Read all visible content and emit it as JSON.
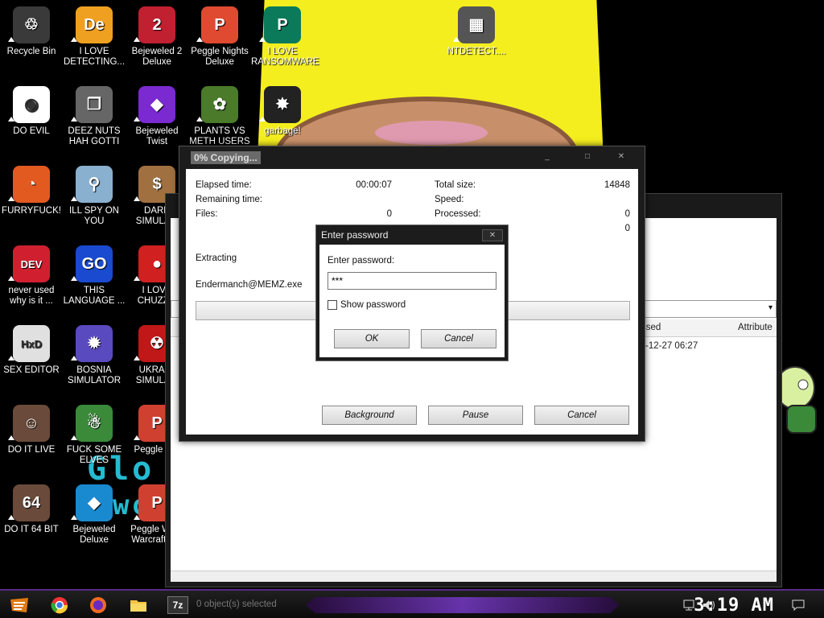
{
  "desktop": {
    "icons": [
      {
        "label": "Recycle Bin",
        "icon": "recycle-bin-icon",
        "color": "#3a3a3a",
        "glyph": "♲"
      },
      {
        "label": "I LOVE\nDETECTING...",
        "icon": "de-icon",
        "color": "#f0a020",
        "glyph": "De"
      },
      {
        "label": "Bejeweled 2\nDeluxe",
        "icon": "bejeweled2-icon",
        "color": "#c02030",
        "glyph": "2"
      },
      {
        "label": "Peggle Nights\nDeluxe",
        "icon": "peggle-nights-icon",
        "color": "#e04a30",
        "glyph": "P"
      },
      {
        "label": "I LOVE\nRANSOMWARE",
        "icon": "publisher-icon",
        "color": "#0b7a5a",
        "glyph": "P"
      },
      {
        "label": "NTDETECT....",
        "icon": "ntdetect-icon",
        "color": "#555",
        "glyph": "▦"
      },
      {
        "label": "DO EVIL",
        "icon": "chrome-icon",
        "color": "#ffffff",
        "glyph": "◉"
      },
      {
        "label": "DEEZ NUTS\nHAH GOTTI",
        "icon": "windows-copy-icon",
        "color": "#666",
        "glyph": "❐"
      },
      {
        "label": "Bejeweled\nTwist",
        "icon": "bejeweled-twist-icon",
        "color": "#7a2ad0",
        "glyph": "◆"
      },
      {
        "label": "PLANTS VS\nMETH USERS",
        "icon": "plants-icon",
        "color": "#4a7a2a",
        "glyph": "✿"
      },
      {
        "label": "garbage!",
        "icon": "garbage-icon",
        "color": "#222",
        "glyph": "✸"
      },
      {
        "label": "FURRYFUCK!",
        "icon": "firefox-icon",
        "color": "#e25a20",
        "glyph": "◔"
      },
      {
        "label": "ILL SPY ON\nYOU",
        "icon": "spy-icon",
        "color": "#8ab0d0",
        "glyph": "⚲"
      },
      {
        "label": "DARK\nSIMULA...",
        "icon": "money-bag-icon",
        "color": "#a07040",
        "glyph": "$"
      },
      {
        "label": "never used\nwhy is it ...",
        "icon": "dev-cpp-icon",
        "color": "#d02030",
        "glyph": "DEV"
      },
      {
        "label": "THIS\nLANGUAGE ...",
        "icon": "goland-icon",
        "color": "#1a4ad0",
        "glyph": "GO"
      },
      {
        "label": "I LOVE\nCHUZZ...",
        "icon": "chuzzle-icon",
        "color": "#d02020",
        "glyph": "●"
      },
      {
        "label": "SEX EDITOR",
        "icon": "hxd-icon",
        "color": "#e0e0e0",
        "glyph": "HxD"
      },
      {
        "label": "BOSNIA\nSIMULATOR",
        "icon": "mine-icon",
        "color": "#5a4ac0",
        "glyph": "✹"
      },
      {
        "label": "UKRAI...\nSIMULA...",
        "icon": "radiation-icon",
        "color": "#c01818",
        "glyph": "☢"
      },
      {
        "label": "DO IT LIVE",
        "icon": "portrait-icon",
        "color": "#6a4a3a",
        "glyph": "☺"
      },
      {
        "label": "FUCK SOME\nELVES",
        "icon": "elves-icon",
        "color": "#3a8a3a",
        "glyph": "☃"
      },
      {
        "label": "Peggle D...",
        "icon": "peggle-deluxe-icon",
        "color": "#d04030",
        "glyph": "P"
      },
      {
        "label": "DO IT 64 BIT",
        "icon": "portrait-64-icon",
        "color": "#6a4a3a",
        "glyph": "64"
      },
      {
        "label": "Bejeweled\nDeluxe",
        "icon": "bejeweled-icon",
        "color": "#1a8ad0",
        "glyph": "◆"
      },
      {
        "label": "Peggle Wo...\nWarcraft E...",
        "icon": "peggle-wow-icon",
        "color": "#d04030",
        "glyph": "P"
      }
    ]
  },
  "wallpaper": {
    "text1": "Glo",
    "text2": "wo"
  },
  "explorer": {
    "col_processed": "ssed",
    "col_attributes": "Attribute",
    "row_date": "-12-27 06:27",
    "status": "0 object(s) selected"
  },
  "copy": {
    "title": "0% Copying...",
    "elapsed_label": "Elapsed time:",
    "elapsed_value": "00:00:07",
    "remaining_label": "Remaining time:",
    "files_label": "Files:",
    "files_value": "0",
    "total_size_label": "Total size:",
    "total_size_value": "14848",
    "speed_label": "Speed:",
    "processed_label": "Processed:",
    "processed_value": "0",
    "extra_value": "0",
    "extracting_label": "Extracting",
    "filename": "Endermanch@MEMZ.exe",
    "btn_background": "Background",
    "btn_pause": "Pause",
    "btn_cancel": "Cancel",
    "progress": 0
  },
  "password": {
    "title": "Enter password",
    "field_label": "Enter password:",
    "value": "***",
    "show_label": "Show password",
    "ok": "OK",
    "cancel": "Cancel"
  },
  "taskbar": {
    "clock": "3:19 AM",
    "app_7z": "7z"
  }
}
